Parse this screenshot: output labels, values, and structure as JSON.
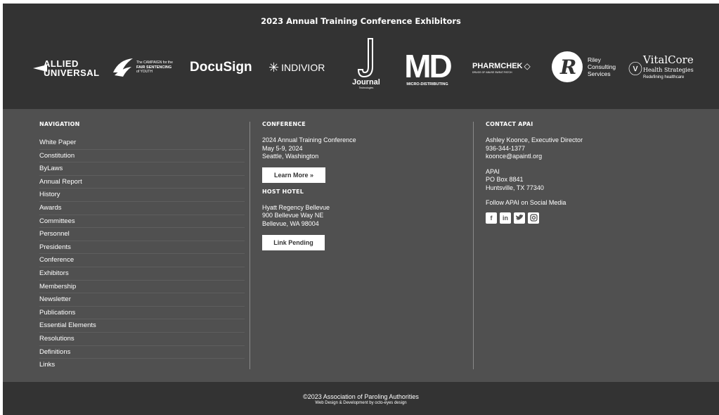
{
  "exhibitors": {
    "title": "2023 Annual Training Conference Exhibitors",
    "logos": [
      {
        "name": "allied-universal",
        "line1": "ALLIED",
        "line2": "UNIVERSAL"
      },
      {
        "name": "campaign-fair-sentencing",
        "line1": "The CAMPAIGN for the",
        "line2": "FAIR SENTENCING",
        "line3": "of YOUTH"
      },
      {
        "name": "docusign",
        "text": "DocuSign"
      },
      {
        "name": "indivior",
        "text": "INDIVIOR"
      },
      {
        "name": "journal-technologies",
        "text": "Journal",
        "sub": "Technologies"
      },
      {
        "name": "micro-distributing",
        "big": "MD",
        "sub": "MICRO-DISTRIBUTING"
      },
      {
        "name": "pharmchek",
        "text": "PHARMCHEK",
        "sub": "DRUGS OF ABUSE SWEAT PATCH"
      },
      {
        "name": "riley-consulting",
        "line1": "Riley",
        "line2": "Consulting",
        "line3": "Services"
      },
      {
        "name": "vitalcore",
        "line1": "VitalCore",
        "line2": "Health Strategies",
        "line3": "Redefining healthcare"
      }
    ]
  },
  "navigation": {
    "heading": "NAVIGATION",
    "items": [
      "White Paper",
      "Constitution",
      "ByLaws",
      "Annual Report",
      "History",
      "Awards",
      "Committees",
      "Personnel",
      "Presidents",
      "Conference",
      "Exhibitors",
      "Membership",
      "Newsletter",
      "Publications",
      "Essential Elements",
      "Resolutions",
      "Definitions",
      "Links"
    ]
  },
  "conference": {
    "heading": "CONFERENCE",
    "line1": "2024 Annual Training Conference",
    "line2": "May 5-9, 2024",
    "line3": "Seattle, Washington",
    "button": "Learn More »",
    "hotel_heading": "HOST HOTEL",
    "hotel1": "Hyatt Regency Bellevue",
    "hotel2": "900 Bellevue Way NE",
    "hotel3": "Bellevue, WA 98004",
    "hotel_button": "Link Pending"
  },
  "contact": {
    "heading": "CONTACT APAI",
    "name": "Ashley Koonce, Executive Director",
    "phone": "936-344-1377",
    "email": "koonce@apaintl.org",
    "org": "APAI",
    "po": "PO Box 8841",
    "city": "Huntsville, TX 77340",
    "social_text": "Follow APAI on Social Media",
    "social": [
      "facebook-icon",
      "linkedin-icon",
      "twitter-icon",
      "instagram-icon"
    ]
  },
  "footer": {
    "copyright": "©2023 Association of Paroling Authorities",
    "credit": "Web Design & Development by octo-eyes design"
  },
  "colors": {
    "band_dark": "#333333",
    "panel": "#505050",
    "text": "#ffffff"
  }
}
